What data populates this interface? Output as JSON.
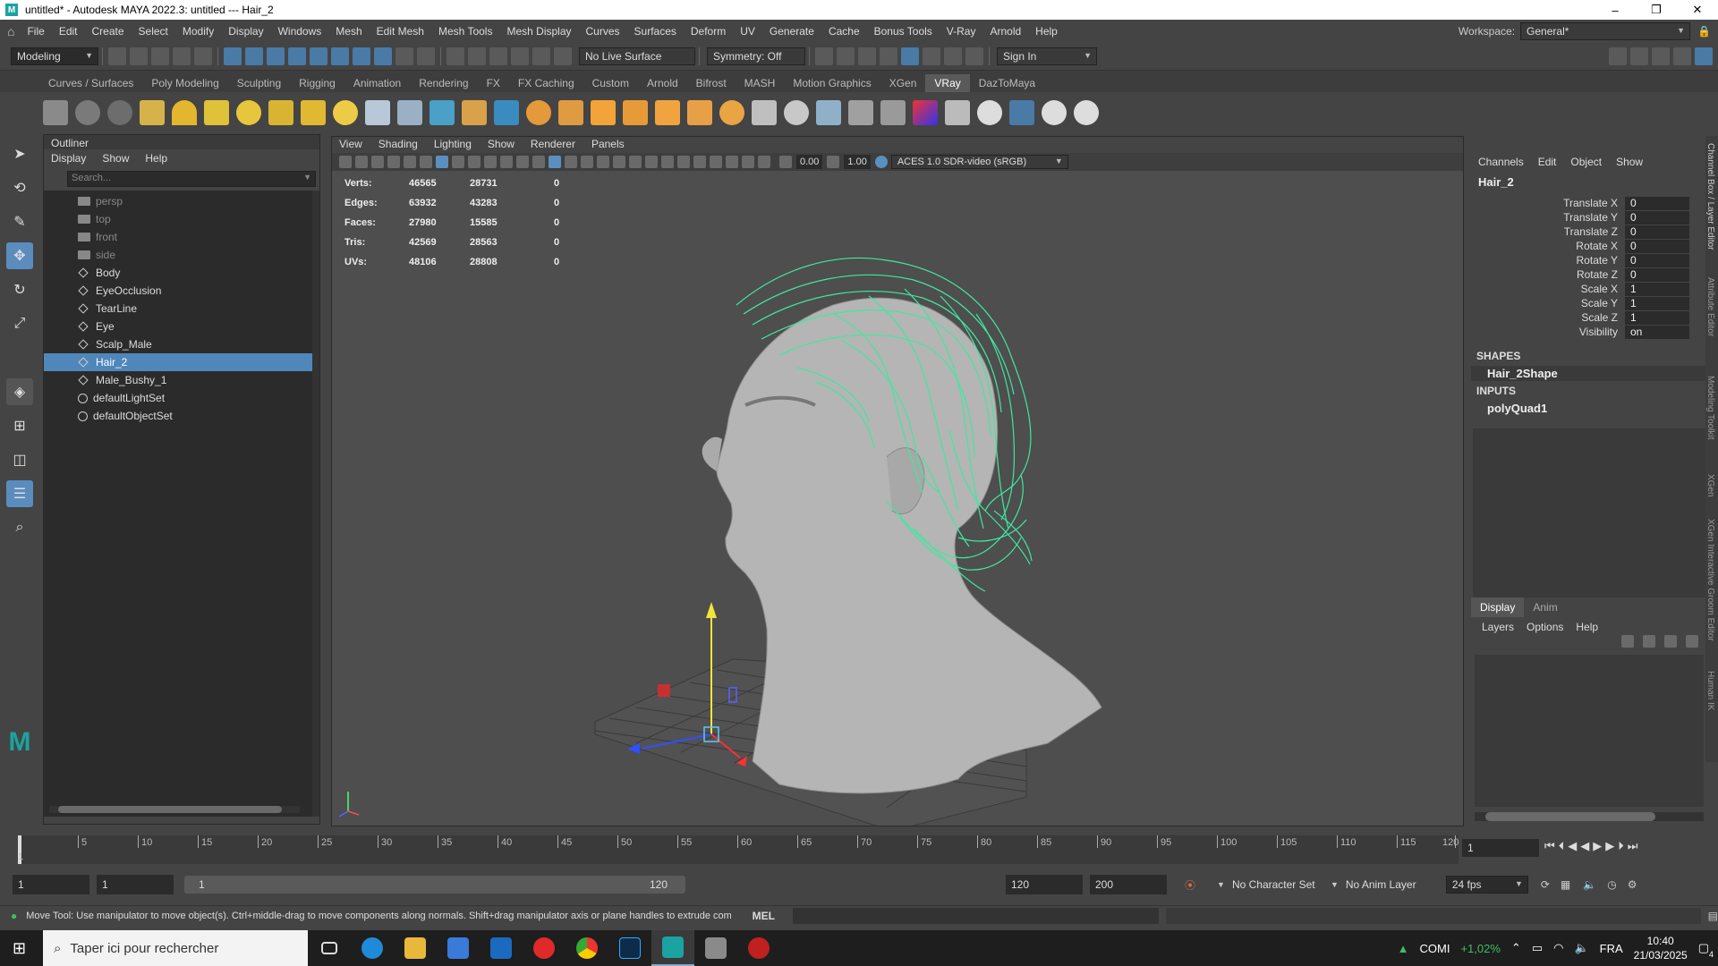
{
  "window": {
    "title": "untitled* - Autodesk MAYA 2022.3: untitled  ---  Hair_2",
    "logo_letter": "M",
    "controls": [
      "–",
      "❐",
      "✕"
    ]
  },
  "menubar": {
    "items": [
      "File",
      "Edit",
      "Create",
      "Select",
      "Modify",
      "Display",
      "Windows",
      "Mesh",
      "Edit Mesh",
      "Mesh Tools",
      "Mesh Display",
      "Curves",
      "Surfaces",
      "Deform",
      "UV",
      "Generate",
      "Cache",
      "Bonus Tools",
      "V-Ray",
      "Arnold",
      "Help"
    ],
    "workspace_label": "Workspace:",
    "workspace_value": "General*"
  },
  "statusline": {
    "mode": "Modeling",
    "live_surface": "No Live Surface",
    "symmetry": "Symmetry: Off",
    "sign_in": "Sign In"
  },
  "shelf": {
    "tabs": [
      "Curves / Surfaces",
      "Poly Modeling",
      "Sculpting",
      "Rigging",
      "Animation",
      "Rendering",
      "FX",
      "FX Caching",
      "Custom",
      "Arnold",
      "Bifrost",
      "MASH",
      "Motion Graphics",
      "XGen",
      "VRay",
      "DazToMaya"
    ],
    "active_tab": "VRay"
  },
  "outliner": {
    "title": "Outliner",
    "menu": [
      "Display",
      "Show",
      "Help"
    ],
    "search_placeholder": "Search...",
    "items": [
      {
        "label": "persp",
        "kind": "cam"
      },
      {
        "label": "top",
        "kind": "cam"
      },
      {
        "label": "front",
        "kind": "cam"
      },
      {
        "label": "side",
        "kind": "cam"
      },
      {
        "label": "Body",
        "kind": "mesh"
      },
      {
        "label": "EyeOcclusion",
        "kind": "mesh"
      },
      {
        "label": "TearLine",
        "kind": "mesh"
      },
      {
        "label": "Eye",
        "kind": "mesh"
      },
      {
        "label": "Scalp_Male",
        "kind": "mesh"
      },
      {
        "label": "Hair_2",
        "kind": "mesh",
        "selected": true
      },
      {
        "label": "Male_Bushy_1",
        "kind": "mesh"
      },
      {
        "label": "defaultLightSet",
        "kind": "set"
      },
      {
        "label": "defaultObjectSet",
        "kind": "set"
      }
    ]
  },
  "viewport": {
    "menu": [
      "View",
      "Shading",
      "Lighting",
      "Show",
      "Renderer",
      "Panels"
    ],
    "exposure": "0.00",
    "gamma": "1.00",
    "colorspace": "ACES 1.0 SDR-video (sRGB)",
    "hud": [
      {
        "label": "Verts:",
        "a": "46565",
        "b": "28731",
        "c": "0"
      },
      {
        "label": "Edges:",
        "a": "63932",
        "b": "43283",
        "c": "0"
      },
      {
        "label": "Faces:",
        "a": "27980",
        "b": "15585",
        "c": "0"
      },
      {
        "label": "Tris:",
        "a": "42569",
        "b": "28563",
        "c": "0"
      },
      {
        "label": "UVs:",
        "a": "48106",
        "b": "28808",
        "c": "0"
      }
    ]
  },
  "channelbox": {
    "menu": [
      "Channels",
      "Edit",
      "Object",
      "Show"
    ],
    "object": "Hair_2",
    "attrs": [
      {
        "label": "Translate X",
        "value": "0"
      },
      {
        "label": "Translate Y",
        "value": "0"
      },
      {
        "label": "Translate Z",
        "value": "0"
      },
      {
        "label": "Rotate X",
        "value": "0"
      },
      {
        "label": "Rotate Y",
        "value": "0"
      },
      {
        "label": "Rotate Z",
        "value": "0"
      },
      {
        "label": "Scale X",
        "value": "1"
      },
      {
        "label": "Scale Y",
        "value": "1"
      },
      {
        "label": "Scale Z",
        "value": "1"
      },
      {
        "label": "Visibility",
        "value": "on"
      }
    ],
    "shapes_title": "SHAPES",
    "shape": "Hair_2Shape",
    "inputs_title": "INPUTS",
    "input": "polyQuad1"
  },
  "layereditor": {
    "tabs": [
      "Display",
      "Anim"
    ],
    "menu": [
      "Layers",
      "Options",
      "Help"
    ]
  },
  "sidetabs": [
    "Channel Box / Layer Editor",
    "Attribute Editor",
    "Modeling Toolkit",
    "XGen",
    "XGen Interactive Groom Editor",
    "Human IK"
  ],
  "timeline": {
    "labels": [
      "1",
      "5",
      "10",
      "15",
      "20",
      "25",
      "30",
      "35",
      "40",
      "45",
      "50",
      "55",
      "60",
      "65",
      "70",
      "75",
      "80",
      "85",
      "90",
      "95",
      "100",
      "105",
      "110",
      "115",
      "120"
    ],
    "current_frame": "1"
  },
  "range": {
    "start": "1",
    "playback_start": "1",
    "slider_start": "1",
    "slider_end": "120",
    "playback_end": "120",
    "end": "200",
    "character_set": "No Character Set",
    "anim_layer": "No Anim Layer",
    "fps": "24 fps"
  },
  "helpline": {
    "message": "Move Tool: Use manipulator to move object(s). Ctrl+middle-drag to move components along normals. Shift+drag manipulator axis or plane handles to extrude components or c",
    "mel": "MEL"
  },
  "taskbar": {
    "search_placeholder": "Taper ici pour rechercher",
    "ticker_name": "COMI",
    "ticker_change": "+1,02%",
    "lang": "FRA",
    "time": "10:40",
    "date": "21/03/2025",
    "notif": "4"
  }
}
